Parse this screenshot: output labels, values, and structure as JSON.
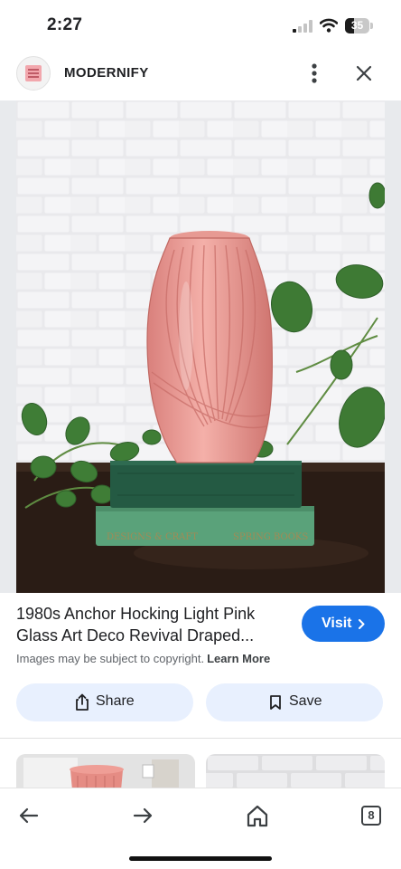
{
  "status_bar": {
    "time": "2:27",
    "battery": "35"
  },
  "header": {
    "site_name": "MODERNIFY",
    "more_icon": "more-vert-icon",
    "close_icon": "close-icon"
  },
  "main": {
    "title_line1": "1980s Anchor Hocking Light Pink",
    "title_line2": "Glass Art Deco Revival Draped...",
    "visit_label": "Visit",
    "copyright_text": "Images may be subject to copyright.",
    "learn_more_label": "Learn More",
    "share_label": "Share",
    "save_label": "Save"
  },
  "image_text": {
    "book_spine_left": "DESIGNS & CRAFT",
    "book_spine_right": "SPRING BOOKS"
  },
  "bottom_nav": {
    "tab_count": "8"
  },
  "colors": {
    "accent": "#1a73e8",
    "pill_bg": "#e8f0fe",
    "vase": "#e89a95",
    "book_dark": "#245a43",
    "book_light": "#5aa27a"
  }
}
